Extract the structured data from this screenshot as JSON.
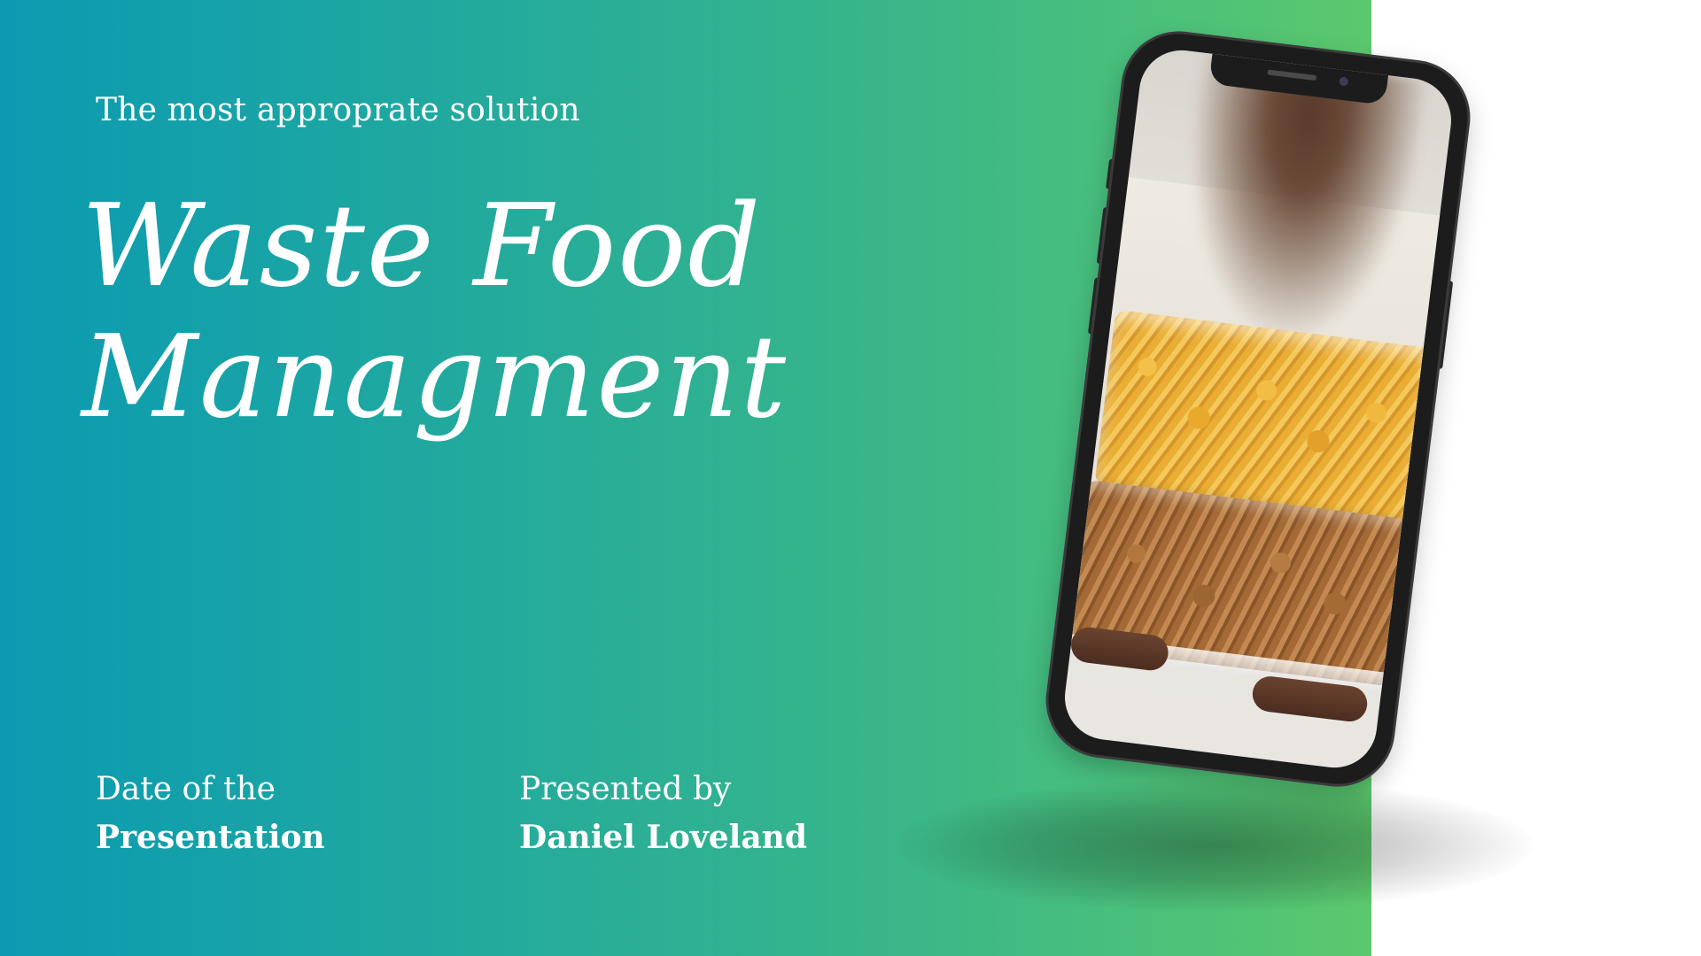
{
  "slide": {
    "subtitle": "The most approprate solution",
    "title_line1": "Waste Food",
    "title_line2": "Managment",
    "date_label": "Date of the",
    "date_value": "Presentation",
    "presenter_label": "Presented by",
    "presenter_name": "Daniel Loveland"
  },
  "colors": {
    "gradient_start": "#0b9ab2",
    "gradient_end": "#5bc86d",
    "text": "#ffffff",
    "background": "#ffffff"
  },
  "phone": {
    "icon": "smartphone-mockup",
    "photo_subject": "pasta-bags-photo"
  }
}
